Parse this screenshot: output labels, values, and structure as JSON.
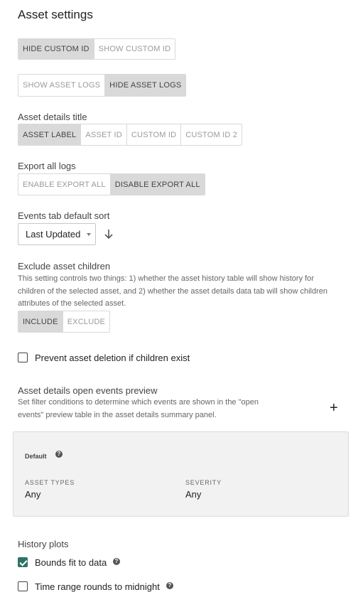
{
  "page": {
    "title": "Asset settings"
  },
  "custom_id": {
    "options": [
      "HIDE CUSTOM ID",
      "SHOW CUSTOM ID"
    ],
    "selected": "HIDE CUSTOM ID"
  },
  "asset_logs": {
    "options": [
      "SHOW ASSET LOGS",
      "HIDE ASSET LOGS"
    ],
    "selected": "HIDE ASSET LOGS"
  },
  "details_title": {
    "label": "Asset details title",
    "options": [
      "ASSET LABEL",
      "ASSET ID",
      "CUSTOM ID",
      "CUSTOM ID 2"
    ],
    "selected": "ASSET LABEL"
  },
  "export_logs": {
    "label": "Export all logs",
    "options": [
      "ENABLE EXPORT ALL",
      "DISABLE EXPORT ALL"
    ],
    "selected": "DISABLE EXPORT ALL"
  },
  "events_sort": {
    "label": "Events tab default sort",
    "value": "Last Updated",
    "direction_icon": "arrow-down-icon"
  },
  "exclude_children": {
    "label": "Exclude asset children",
    "help_lines": [
      "This setting controls two things: 1) whether the asset history table will show history for",
      "children of the selected asset, and 2) whether the asset details data tab will show children",
      "attributes of the selected asset."
    ],
    "options": [
      "INCLUDE",
      "EXCLUDE"
    ],
    "selected": "INCLUDE"
  },
  "prevent_deletion": {
    "label": "Prevent asset deletion if children exist",
    "checked": false
  },
  "open_events": {
    "label": "Asset details open events preview",
    "help_lines": [
      "Set filter conditions to determine which events are shown in the \"open",
      "events\" preview table in the asset details summary panel."
    ],
    "add_icon": "+",
    "card": {
      "title": "Default",
      "fields": [
        {
          "label": "ASSET TYPES",
          "value": "Any"
        },
        {
          "label": "SEVERITY",
          "value": "Any"
        }
      ]
    }
  },
  "history_plots": {
    "label": "History plots",
    "bounds_fit": {
      "label": "Bounds fit to data",
      "checked": true
    },
    "rounds_midnight": {
      "label": "Time range rounds to midnight",
      "checked": false
    }
  },
  "colors": {
    "accent": "#2d7367",
    "selected_segment": "#d9d9d9",
    "card_bg": "#f2f2f2"
  }
}
